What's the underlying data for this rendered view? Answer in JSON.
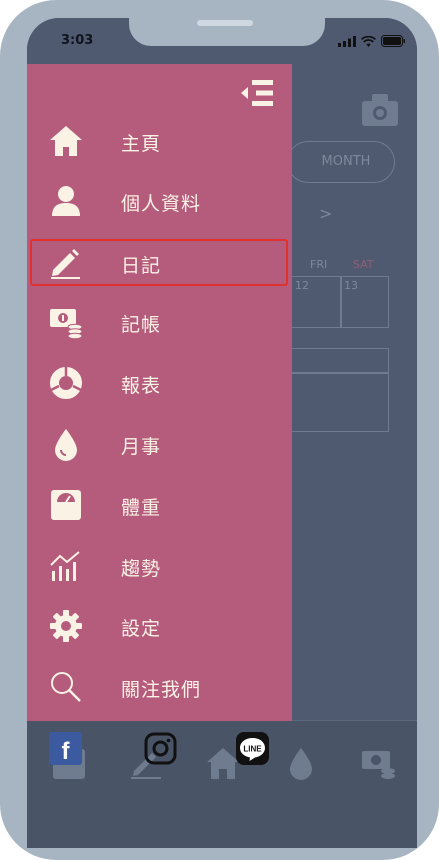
{
  "status_bar": {
    "time": "3:03"
  },
  "background": {
    "month_button": "MONTH",
    "next_arrow": ">",
    "weekdays": [
      "FRI",
      "SAT"
    ],
    "dates": [
      "12",
      "13"
    ]
  },
  "drawer": {
    "menu": [
      {
        "label": "主頁",
        "icon": "home-icon"
      },
      {
        "label": "個人資料",
        "icon": "user-icon"
      },
      {
        "label": "日記",
        "icon": "pencil-icon",
        "selected": true
      },
      {
        "label": "記帳",
        "icon": "money-icon"
      },
      {
        "label": "報表",
        "icon": "donut-chart-icon"
      },
      {
        "label": "月事",
        "icon": "drop-icon"
      },
      {
        "label": "體重",
        "icon": "scale-icon"
      },
      {
        "label": "趨勢",
        "icon": "trend-chart-icon"
      },
      {
        "label": "設定",
        "icon": "gear-icon"
      },
      {
        "label": "關注我們",
        "icon": "search-icon"
      }
    ],
    "socials": [
      {
        "name": "facebook-icon",
        "text": "f"
      },
      {
        "name": "instagram-icon"
      },
      {
        "name": "line-icon",
        "text": "LINE"
      }
    ]
  },
  "colors": {
    "drawer_bg": "#b55c7d",
    "overlay_bg": "#4f5a71",
    "menu_text": "#fbf2e6",
    "selection_border": "#e03030",
    "frame": "#a7b5c3"
  }
}
